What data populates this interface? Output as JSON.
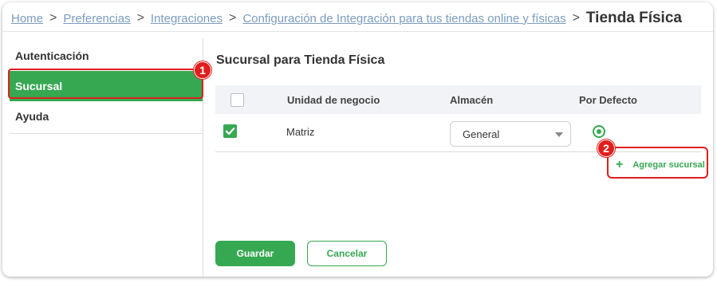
{
  "breadcrumb": {
    "links": [
      "Home",
      "Preferencias",
      "Integraciones",
      "Configuración de Integración para tus tiendas online y físicas"
    ],
    "separator": ">",
    "current": "Tienda Física"
  },
  "sidebar": {
    "items": [
      {
        "label": "Autenticación",
        "active": false
      },
      {
        "label": "Sucursal",
        "active": true
      },
      {
        "label": "Ayuda",
        "active": false
      }
    ]
  },
  "annotations": {
    "badge1": "1",
    "badge2": "2"
  },
  "main": {
    "title": "Sucursal para Tienda Física",
    "table": {
      "columns": [
        "Unidad de negocio",
        "Almacén",
        "Por Defecto"
      ],
      "rows": [
        {
          "checked": true,
          "business_unit": "Matriz",
          "warehouse": "General",
          "default": true
        }
      ]
    },
    "add_branch_label": "Agregar sucursal",
    "save_label": "Guardar",
    "cancel_label": "Cancelar"
  },
  "colors": {
    "accent": "#36a852",
    "highlight": "#e01e1e",
    "link": "#7a9cc0"
  },
  "icons": {
    "plus": "plus-icon",
    "checkbox": "checkbox-icon",
    "radio": "radio-icon",
    "caret": "chevron-down-icon"
  }
}
